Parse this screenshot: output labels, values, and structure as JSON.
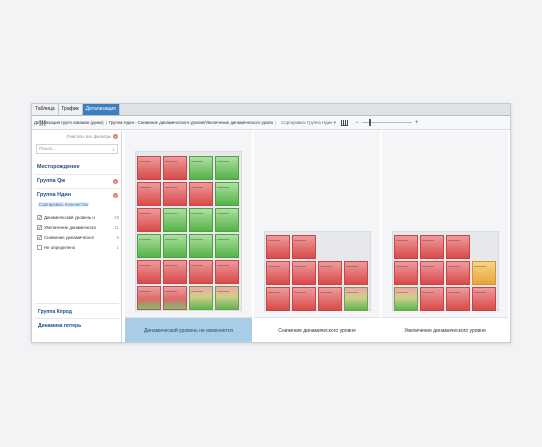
{
  "tabs": [
    "Таблица",
    "График",
    "Детализация"
  ],
  "active_tab": 2,
  "toolbar": {
    "crumb_main": "Детализация групп скважин (демо)",
    "crumb_path": "Группа Ндин - Снижение динамического уровня/Увеличение динамического уровн",
    "sort_label": "Сортировка: Группа Ндин ▾"
  },
  "sidebar": {
    "clear_filters": "Очистить все фильтры",
    "search_placeholder": "Поиск...",
    "filters": [
      "Месторождение",
      "Группа Qж",
      "Группа Ндин"
    ],
    "sort_tag": "Сортировка: Количество",
    "checks": [
      {
        "label": "Динамический уровень н",
        "count": "29",
        "checked": true
      },
      {
        "label": "Увеличение динамическо",
        "count": "11",
        "checked": true
      },
      {
        "label": "Снижение динамическог",
        "count": "9",
        "checked": true
      },
      {
        "label": "Не определено",
        "count": "1",
        "checked": false
      }
    ],
    "footer_links": [
      "Группа Кпрод",
      "Динамика потерь"
    ]
  },
  "panels": [
    {
      "label": "Динамический уровень не изменяется",
      "selected": true,
      "cols": 4,
      "cells": [
        "r",
        "r",
        "g",
        "g",
        "r",
        "r",
        "r",
        "g",
        "r",
        "g",
        "g",
        "g",
        "g",
        "g",
        "g",
        "g",
        "r",
        "r",
        "r",
        "r",
        "m",
        "m",
        "n",
        "n"
      ]
    },
    {
      "label": "Снижение динамического уровня",
      "selected": false,
      "cols": 4,
      "cells": [
        "r",
        "r",
        "e",
        "e",
        "r",
        "r",
        "r",
        "r",
        "r",
        "r",
        "r",
        "n"
      ]
    },
    {
      "label": "Увеличение динамического уровня",
      "selected": false,
      "cols": 4,
      "cells": [
        "r",
        "r",
        "r",
        "e",
        "r",
        "r",
        "r",
        "o",
        "n",
        "r",
        "r",
        "r"
      ]
    }
  ]
}
